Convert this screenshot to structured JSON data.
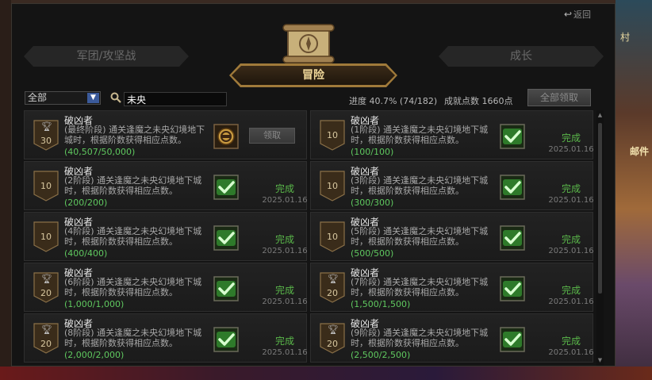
{
  "header": {
    "back_label": "返回",
    "tabs": {
      "legion": "军团/攻坚战",
      "adventure": "冒险",
      "growth": "成长"
    }
  },
  "filter": {
    "selected": "全部",
    "search_value": "未央",
    "progress": "进度 40.7% (74/182)",
    "points": "成就点数 1660点",
    "claim_all": "全部领取"
  },
  "achievements": [
    {
      "title": "破凶者",
      "desc": "(最终阶段) 通关逢魔之未央幻境地下城时，根据阶数获得相应点数。",
      "progress": "(40,507/50,000)",
      "points": "30",
      "status": "claim",
      "claim_label": "领取",
      "trophy": true
    },
    {
      "title": "破凶者",
      "desc": "(1阶段) 通关逢魔之未央幻境地下城时，根据阶数获得相应点数。",
      "progress": "(100/100)",
      "points": "10",
      "status": "done",
      "done_label": "完成",
      "date": "2025.01.16",
      "trophy": false
    },
    {
      "title": "破凶者",
      "desc": "(2阶段) 通关逢魔之未央幻境地下城时，根据阶数获得相应点数。",
      "progress": "(200/200)",
      "points": "10",
      "status": "done",
      "done_label": "完成",
      "date": "2025.01.16",
      "trophy": false
    },
    {
      "title": "破凶者",
      "desc": "(3阶段) 通关逢魔之未央幻境地下城时，根据阶数获得相应点数。",
      "progress": "(300/300)",
      "points": "10",
      "status": "done",
      "done_label": "完成",
      "date": "2025.01.16",
      "trophy": false
    },
    {
      "title": "破凶者",
      "desc": "(4阶段) 通关逢魔之未央幻境地下城时，根据阶数获得相应点数。",
      "progress": "(400/400)",
      "points": "10",
      "status": "done",
      "done_label": "完成",
      "date": "2025.01.16",
      "trophy": false
    },
    {
      "title": "破凶者",
      "desc": "(5阶段) 通关逢魔之未央幻境地下城时，根据阶数获得相应点数。",
      "progress": "(500/500)",
      "points": "10",
      "status": "done",
      "done_label": "完成",
      "date": "2025.01.16",
      "trophy": false
    },
    {
      "title": "破凶者",
      "desc": "(6阶段) 通关逢魔之未央幻境地下城时，根据阶数获得相应点数。",
      "progress": "(1,000/1,000)",
      "points": "20",
      "status": "done",
      "done_label": "完成",
      "date": "2025.01.16",
      "trophy": true
    },
    {
      "title": "破凶者",
      "desc": "(7阶段) 通关逢魔之未央幻境地下城时，根据阶数获得相应点数。",
      "progress": "(1,500/1,500)",
      "points": "20",
      "status": "done",
      "done_label": "完成",
      "date": "2025.01.16",
      "trophy": true
    },
    {
      "title": "破凶者",
      "desc": "(8阶段) 通关逢魔之未央幻境地下城时，根据阶数获得相应点数。",
      "progress": "(2,000/2,000)",
      "points": "20",
      "status": "done",
      "done_label": "完成",
      "date": "2025.01.16",
      "trophy": true
    },
    {
      "title": "破凶者",
      "desc": "(9阶段) 通关逢魔之未央幻境地下城时，根据阶数获得相应点数。",
      "progress": "(2,500/2,500)",
      "points": "20",
      "status": "done",
      "done_label": "完成",
      "date": "2025.01.16",
      "trophy": true
    }
  ],
  "background": {
    "village_label": "村",
    "mail_label": "邮件"
  },
  "colors": {
    "accent": "#f0d89a",
    "done": "#5ab84a",
    "progress": "#5fc85f"
  }
}
